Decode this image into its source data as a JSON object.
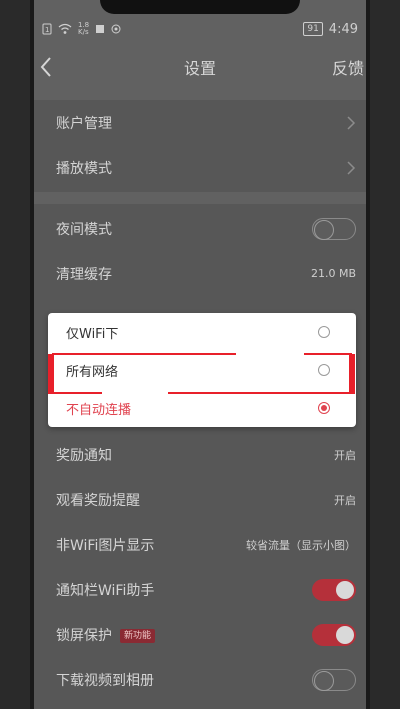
{
  "status_bar": {
    "net_speed_top": "1.8",
    "net_speed_bottom": "K/s",
    "battery": "91",
    "time": "4:49"
  },
  "header": {
    "title": "设置",
    "feedback": "反馈"
  },
  "rows": {
    "account": "账户管理",
    "play_mode": "播放模式",
    "night_mode": "夜间模式",
    "clear_cache": "清理缓存",
    "cache_size": "21.0 MB",
    "reward_notice": "奖励通知",
    "reward_notice_value": "开启",
    "watch_reward": "观看奖励提醒",
    "watch_reward_value": "开启",
    "non_wifi_image": "非WiFi图片显示",
    "non_wifi_image_value": "较省流量（显示小图）",
    "notification_wifi": "通知栏WiFi助手",
    "lock_screen": "锁屏保护",
    "lock_screen_badge": "新功能",
    "download_album": "下载视频到相册"
  },
  "dialog": {
    "options": [
      "仅WiFi下",
      "所有网络",
      "不自动连播"
    ],
    "selected_index": 2
  },
  "colors": {
    "accent": "#e0434f",
    "toggle_on": "#b5303a",
    "annotation": "#e8202a"
  }
}
